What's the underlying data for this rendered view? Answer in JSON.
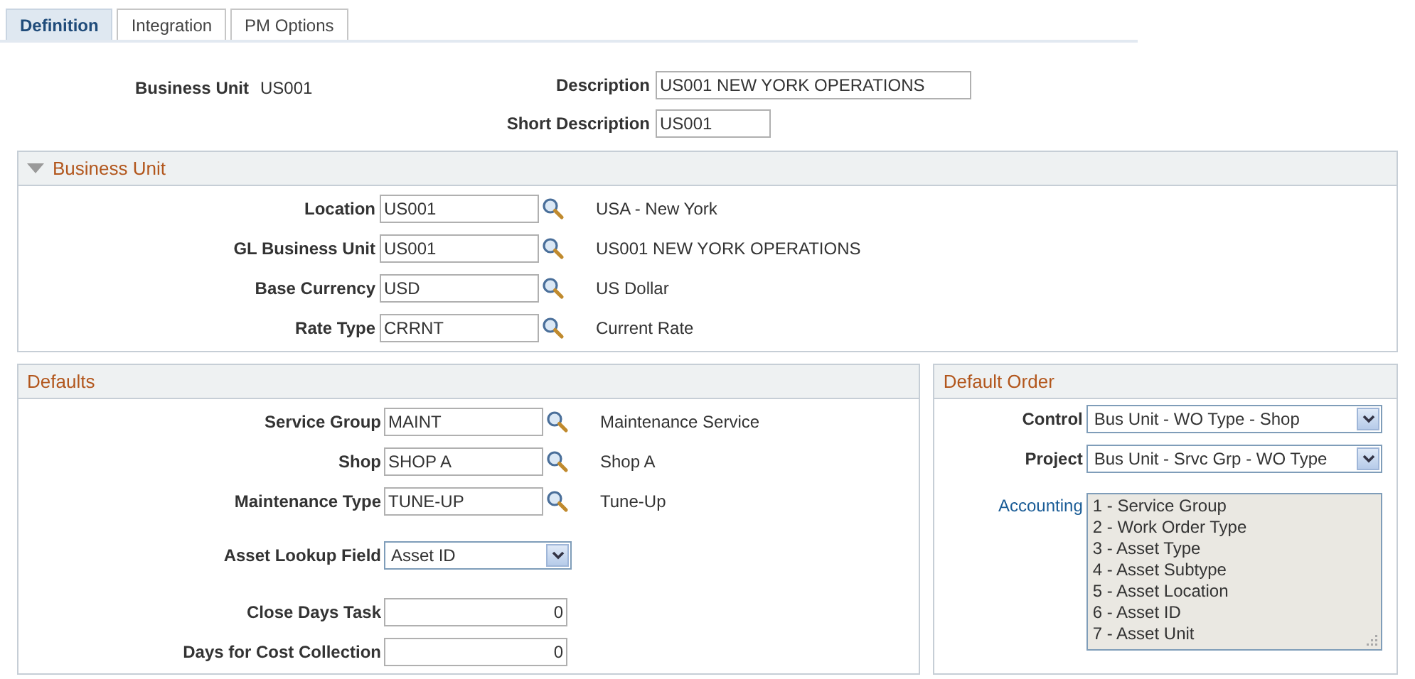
{
  "tabs": [
    {
      "label": "Definition",
      "selected": true
    },
    {
      "label": "Integration",
      "selected": false
    },
    {
      "label": "PM Options",
      "selected": false
    }
  ],
  "header": {
    "business_unit_label": "Business Unit",
    "business_unit_value": "US001",
    "description_label": "Description",
    "description_value": "US001 NEW YORK OPERATIONS",
    "short_description_label": "Short Description",
    "short_description_value": "US001"
  },
  "business_unit_section": {
    "title": "Business Unit",
    "expanded": true,
    "rows": [
      {
        "label": "Location",
        "value": "US001",
        "description": "USA - New York"
      },
      {
        "label": "GL Business Unit",
        "value": "US001",
        "description": "US001 NEW YORK OPERATIONS"
      },
      {
        "label": "Base Currency",
        "value": "USD",
        "description": "US Dollar"
      },
      {
        "label": "Rate Type",
        "value": "CRRNT",
        "description": "Current Rate"
      }
    ]
  },
  "defaults": {
    "title": "Defaults",
    "rows": [
      {
        "kind": "lookup",
        "label": "Service Group",
        "value": "MAINT",
        "description": "Maintenance Service"
      },
      {
        "kind": "lookup",
        "label": "Shop",
        "value": "SHOP A",
        "description": "Shop A"
      },
      {
        "kind": "lookup",
        "label": "Maintenance Type",
        "value": "TUNE-UP",
        "description": "Tune-Up"
      },
      {
        "kind": "select",
        "label": "Asset Lookup Field",
        "value": "Asset ID"
      },
      {
        "kind": "number",
        "label": "Close Days Task",
        "value": "0"
      },
      {
        "kind": "number",
        "label": "Days for Cost Collection",
        "value": "0"
      }
    ]
  },
  "default_order": {
    "title": "Default Order",
    "selects": [
      {
        "label": "Control",
        "value": "Bus Unit - WO Type - Shop"
      },
      {
        "label": "Project",
        "value": "Bus Unit - Srvc Grp - WO Type"
      }
    ],
    "accounting_label": "Accounting",
    "accounting_lines": [
      "1 - Service Group",
      "2 - Work Order Type",
      "3 - Asset Type",
      "4 - Asset Subtype",
      "5 - Asset Location",
      "6 - Asset ID",
      "7 - Asset Unit"
    ]
  }
}
